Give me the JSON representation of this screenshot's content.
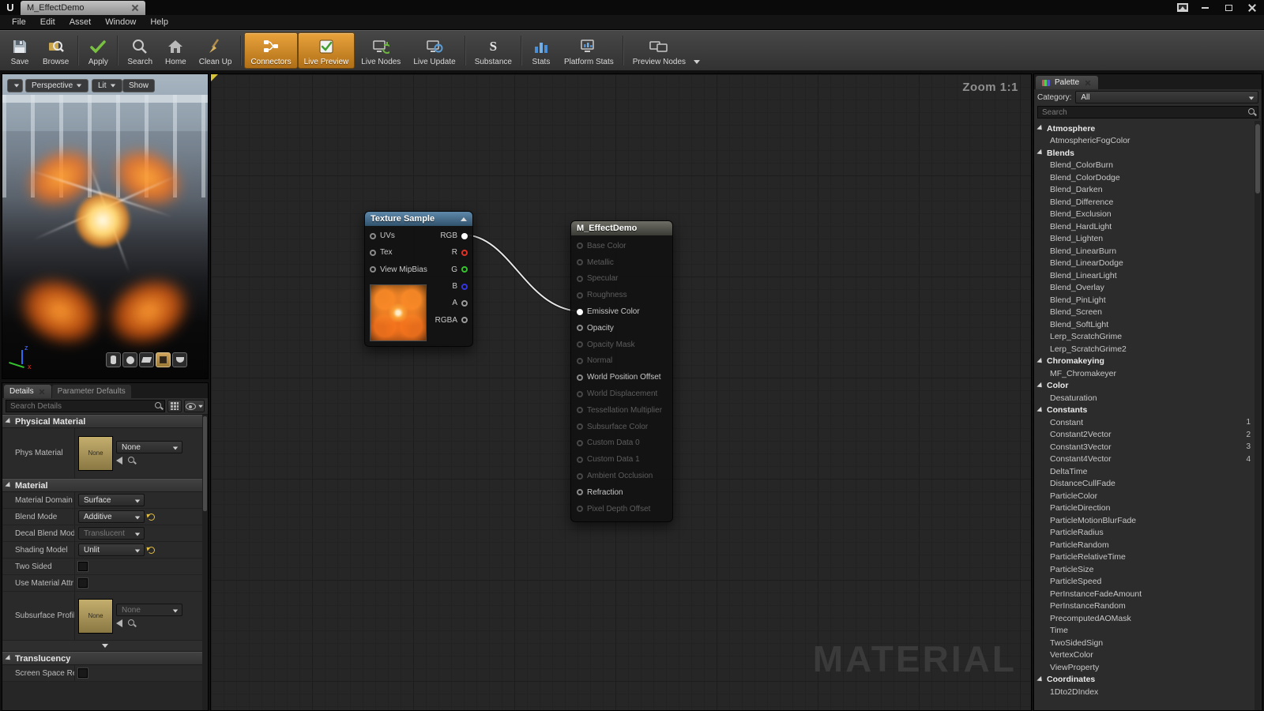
{
  "titlebar": {
    "logo": "U",
    "tab": "M_EffectDemo"
  },
  "menubar": {
    "items": [
      "File",
      "Edit",
      "Asset",
      "Window",
      "Help"
    ]
  },
  "toolbar": {
    "buttons": [
      {
        "label": "Save"
      },
      {
        "label": "Browse"
      },
      {
        "label": "Apply"
      },
      {
        "label": "Search"
      },
      {
        "label": "Home"
      },
      {
        "label": "Clean Up"
      },
      {
        "label": "Connectors",
        "active": true
      },
      {
        "label": "Live Preview",
        "active": true
      },
      {
        "label": "Live Nodes"
      },
      {
        "label": "Live Update"
      },
      {
        "label": "Substance"
      },
      {
        "label": "Stats"
      },
      {
        "label": "Platform Stats"
      },
      {
        "label": "Preview Nodes"
      }
    ],
    "substance_glyph": "S"
  },
  "viewport": {
    "buttons": {
      "perspective": "Perspective",
      "lit": "Lit",
      "show": "Show"
    }
  },
  "details": {
    "tabs": [
      {
        "label": "Details"
      },
      {
        "label": "Parameter Defaults"
      }
    ],
    "search_placeholder": "Search Details",
    "sections": {
      "physical_material": {
        "title": "Physical Material",
        "rows": [
          {
            "label": "Phys Material",
            "value": "None",
            "thumb": "None"
          }
        ]
      },
      "material": {
        "title": "Material",
        "rows": [
          {
            "label": "Material Domain",
            "value": "Surface"
          },
          {
            "label": "Blend Mode",
            "value": "Additive"
          },
          {
            "label": "Decal Blend Mode",
            "value": "Translucent"
          },
          {
            "label": "Shading Model",
            "value": "Unlit"
          },
          {
            "label": "Two Sided"
          },
          {
            "label": "Use Material Attr"
          },
          {
            "label": "Subsurface Profil",
            "value": "None",
            "thumb": "None"
          }
        ]
      },
      "translucency": {
        "title": "Translucency",
        "rows": [
          {
            "label": "Screen Space Ref"
          }
        ]
      }
    }
  },
  "graph": {
    "zoom_label": "Zoom 1:1",
    "watermark": "MATERIAL",
    "colors": {
      "wire": "#e8e8e8",
      "active_orange": "#c98a2b"
    },
    "nodes": {
      "texture_sample": {
        "title": "Texture Sample",
        "inputs": [
          "UVs",
          "Tex",
          "View MipBias"
        ],
        "outputs": [
          {
            "label": "RGB",
            "color": "#ffffff",
            "connected": true
          },
          {
            "label": "R",
            "color": "#e03224"
          },
          {
            "label": "G",
            "color": "#35c42e"
          },
          {
            "label": "B",
            "color": "#3335e0"
          },
          {
            "label": "A",
            "color": "#9a9a9a"
          },
          {
            "label": "RGBA",
            "color": "#9a9a9a"
          }
        ]
      },
      "material_node": {
        "title": "M_EffectDemo",
        "inputs": [
          {
            "label": "Base Color",
            "enabled": false
          },
          {
            "label": "Metallic",
            "enabled": false
          },
          {
            "label": "Specular",
            "enabled": false
          },
          {
            "label": "Roughness",
            "enabled": false
          },
          {
            "label": "Emissive Color",
            "enabled": true,
            "connected": true
          },
          {
            "label": "Opacity",
            "enabled": true
          },
          {
            "label": "Opacity Mask",
            "enabled": false
          },
          {
            "label": "Normal",
            "enabled": false
          },
          {
            "label": "World Position Offset",
            "enabled": true
          },
          {
            "label": "World Displacement",
            "enabled": false
          },
          {
            "label": "Tessellation Multiplier",
            "enabled": false
          },
          {
            "label": "Subsurface Color",
            "enabled": false
          },
          {
            "label": "Custom Data 0",
            "enabled": false
          },
          {
            "label": "Custom Data 1",
            "enabled": false
          },
          {
            "label": "Ambient Occlusion",
            "enabled": false
          },
          {
            "label": "Refraction",
            "enabled": true
          },
          {
            "label": "Pixel Depth Offset",
            "enabled": false
          }
        ]
      }
    }
  },
  "palette": {
    "title": "Palette",
    "category_label": "Category:",
    "category_value": "All",
    "search_placeholder": "Search",
    "items": [
      {
        "label": "Atmosphere",
        "category": true
      },
      {
        "label": "AtmosphericFogColor"
      },
      {
        "label": "Blends",
        "category": true
      },
      {
        "label": "Blend_ColorBurn"
      },
      {
        "label": "Blend_ColorDodge"
      },
      {
        "label": "Blend_Darken"
      },
      {
        "label": "Blend_Difference"
      },
      {
        "label": "Blend_Exclusion"
      },
      {
        "label": "Blend_HardLight"
      },
      {
        "label": "Blend_Lighten"
      },
      {
        "label": "Blend_LinearBurn"
      },
      {
        "label": "Blend_LinearDodge"
      },
      {
        "label": "Blend_LinearLight"
      },
      {
        "label": "Blend_Overlay"
      },
      {
        "label": "Blend_PinLight"
      },
      {
        "label": "Blend_Screen"
      },
      {
        "label": "Blend_SoftLight"
      },
      {
        "label": "Lerp_ScratchGrime"
      },
      {
        "label": "Lerp_ScratchGrime2"
      },
      {
        "label": "Chromakeying",
        "category": true
      },
      {
        "label": "MF_Chromakeyer"
      },
      {
        "label": "Color",
        "category": true
      },
      {
        "label": "Desaturation"
      },
      {
        "label": "Constants",
        "category": true
      },
      {
        "label": "Constant",
        "badge": "1"
      },
      {
        "label": "Constant2Vector",
        "badge": "2"
      },
      {
        "label": "Constant3Vector",
        "badge": "3"
      },
      {
        "label": "Constant4Vector",
        "badge": "4"
      },
      {
        "label": "DeltaTime"
      },
      {
        "label": "DistanceCullFade"
      },
      {
        "label": "ParticleColor"
      },
      {
        "label": "ParticleDirection"
      },
      {
        "label": "ParticleMotionBlurFade"
      },
      {
        "label": "ParticleRadius"
      },
      {
        "label": "ParticleRandom"
      },
      {
        "label": "ParticleRelativeTime"
      },
      {
        "label": "ParticleSize"
      },
      {
        "label": "ParticleSpeed"
      },
      {
        "label": "PerInstanceFadeAmount"
      },
      {
        "label": "PerInstanceRandom"
      },
      {
        "label": "PrecomputedAOMask"
      },
      {
        "label": "Time"
      },
      {
        "label": "TwoSidedSign"
      },
      {
        "label": "VertexColor"
      },
      {
        "label": "ViewProperty"
      },
      {
        "label": "Coordinates",
        "category": true
      },
      {
        "label": "1Dto2DIndex"
      }
    ]
  }
}
